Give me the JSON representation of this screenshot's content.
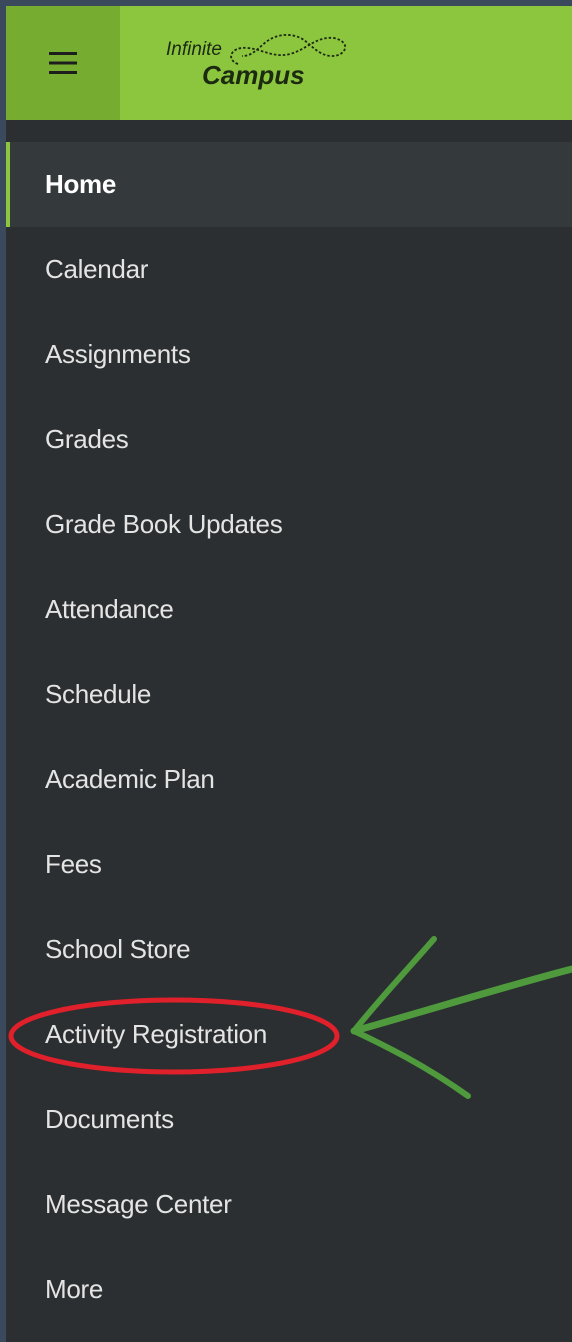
{
  "app": {
    "logo_word_top": "Infinite",
    "logo_word_bottom": "Campus"
  },
  "colors": {
    "header_green": "#8cc63f",
    "menu_button_green": "#76ad31",
    "sidebar_bg": "#2b2f31",
    "active_bg": "#34393b",
    "highlight_red": "#e0202a",
    "arrow_green": "#4e9a3c"
  },
  "header": {
    "menu_icon": "hamburger-menu-icon"
  },
  "nav": {
    "items": [
      {
        "label": "Home",
        "active": true
      },
      {
        "label": "Calendar"
      },
      {
        "label": "Assignments"
      },
      {
        "label": "Grades"
      },
      {
        "label": "Grade Book Updates"
      },
      {
        "label": "Attendance"
      },
      {
        "label": "Schedule"
      },
      {
        "label": "Academic Plan"
      },
      {
        "label": "Fees"
      },
      {
        "label": "School Store"
      },
      {
        "label": "Activity Registration",
        "highlighted": true
      },
      {
        "label": "Documents"
      },
      {
        "label": "Message Center"
      },
      {
        "label": "More"
      }
    ]
  }
}
